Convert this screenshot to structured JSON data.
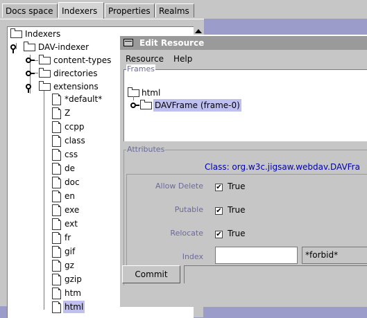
{
  "tabs": [
    {
      "label": "Docs space"
    },
    {
      "label": "Indexers"
    },
    {
      "label": "Properties"
    },
    {
      "label": "Realms"
    }
  ],
  "tree": {
    "root": "Indexers",
    "dav_indexer": "DAV-indexer",
    "content_types": "content-types",
    "directories": "directories",
    "extensions": "extensions",
    "ext_items": [
      "*default*",
      "Z",
      "ccpp",
      "class",
      "css",
      "de",
      "doc",
      "en",
      "exe",
      "ext",
      "fr",
      "gif",
      "gz",
      "gzip",
      "htm",
      "html"
    ],
    "selected": "html"
  },
  "dialog": {
    "title": "Edit Resource",
    "menu": {
      "resource": "Resource",
      "help": "Help"
    },
    "frames": {
      "caption": "Frames",
      "root": "html",
      "child": "DAVFrame (frame-0)"
    },
    "attributes": {
      "caption": "Attributes",
      "class_label": "Class: org.w3c.jigsaw.webdav.DAVFra",
      "allow_delete": {
        "label": "Allow Delete",
        "checked": true,
        "text": "True"
      },
      "putable": {
        "label": "Putable",
        "checked": true,
        "text": "True"
      },
      "relocate": {
        "label": "Relocate",
        "checked": true,
        "text": "True"
      },
      "index": {
        "label": "Index",
        "value": "",
        "select": "*forbid*"
      }
    },
    "commit": "Commit"
  },
  "colors": {
    "background": "#9c9cca",
    "panel": "#c6c6c6",
    "selection": "#c0c0f0",
    "label_muted": "#6a6a9a",
    "class_text": "#0000aa"
  }
}
